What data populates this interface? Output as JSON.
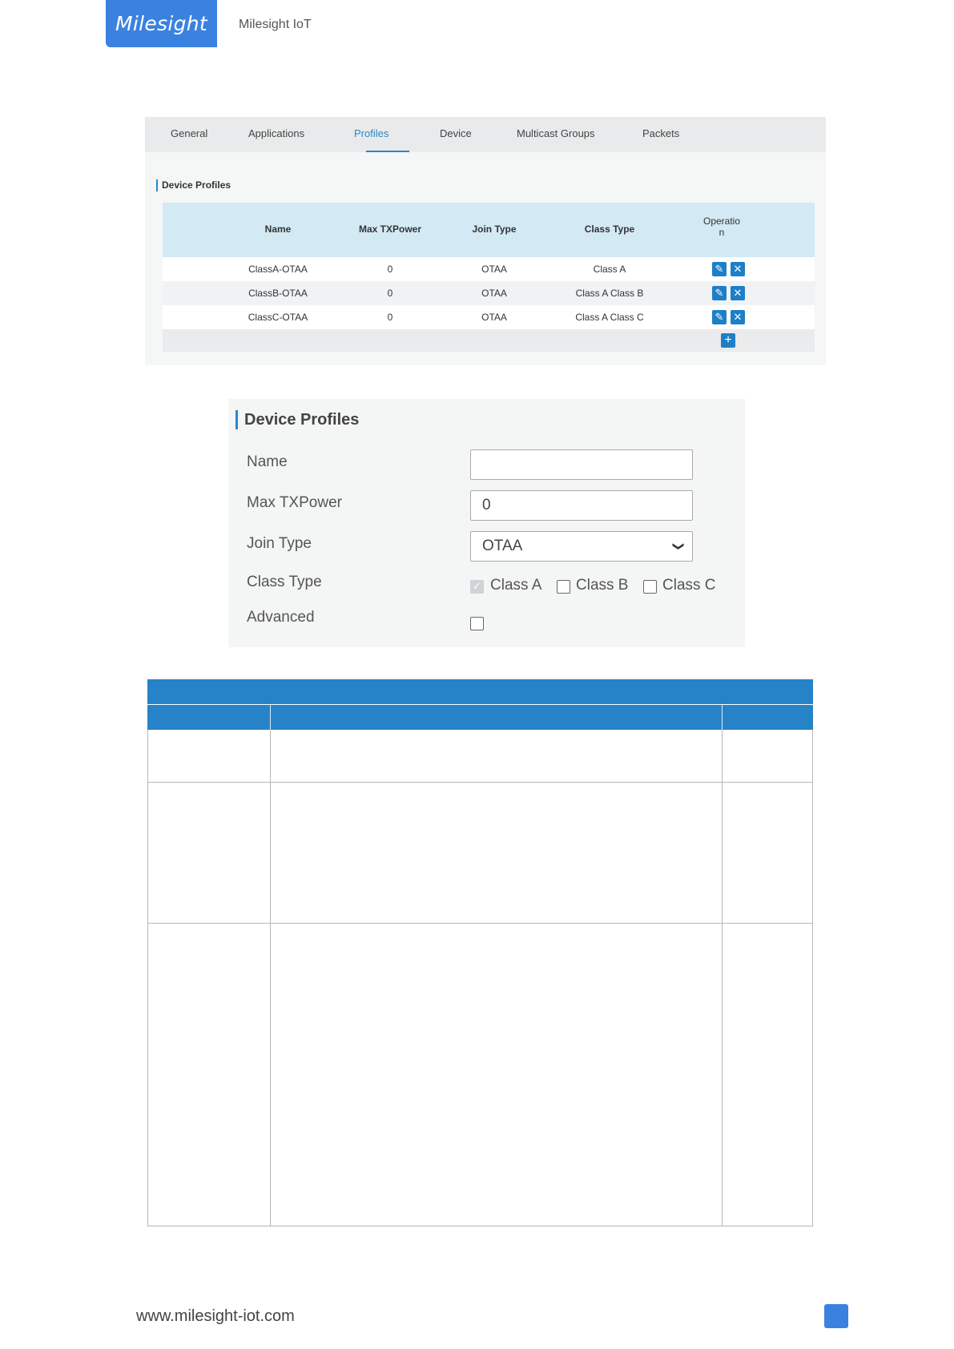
{
  "header": {
    "logo_text": "Milesight",
    "site_name": "Milesight IoT"
  },
  "tabs": [
    "General",
    "Applications",
    "Profiles",
    "Device",
    "Multicast Groups",
    "Packets"
  ],
  "active_tab": "Profiles",
  "profiles_table": {
    "section_title": "Device Profiles",
    "columns": [
      "Name",
      "Max TXPower",
      "Join Type",
      "Class Type",
      "Operatio",
      "n"
    ],
    "rows": [
      {
        "name": "ClassA-OTAA",
        "max_txpower": "0",
        "join_type": "OTAA",
        "class_type": "Class A"
      },
      {
        "name": "ClassB-OTAA",
        "max_txpower": "0",
        "join_type": "OTAA",
        "class_type": "Class A Class B"
      },
      {
        "name": "ClassC-OTAA",
        "max_txpower": "0",
        "join_type": "OTAA",
        "class_type": "Class A Class C"
      }
    ],
    "edit_icon": "pencil-icon",
    "delete_icon": "x-icon",
    "add_icon": "plus-icon"
  },
  "profile_form": {
    "section_title": "Device Profiles",
    "name_label": "Name",
    "name_value": "",
    "max_txpower_label": "Max TXPower",
    "max_txpower_value": "0",
    "join_type_label": "Join Type",
    "join_type_value": "OTAA",
    "class_type_label": "Class Type",
    "class_options": [
      "Class A",
      "Class B",
      "Class C"
    ],
    "class_checked": [
      true,
      false,
      false
    ],
    "advanced_label": "Advanced",
    "advanced_checked": false
  },
  "footer": {
    "url": "www.milesight-iot.com"
  },
  "colors": {
    "brand": "#3b82e0",
    "accent": "#2a88c8",
    "table_header": "#2783c7",
    "table_head_light": "#d3eaf5"
  }
}
